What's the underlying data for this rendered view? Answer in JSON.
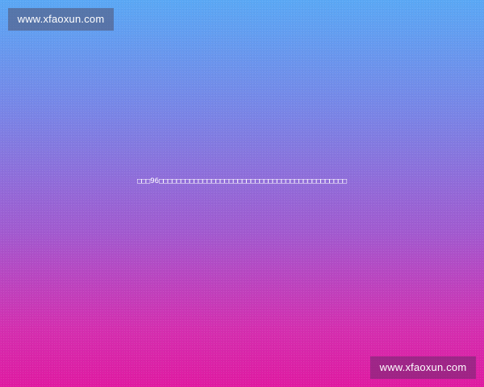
{
  "watermark": {
    "top_text": "www.xfaoxun.com",
    "bottom_text": "www.xfaoxun.com"
  },
  "center": {
    "text": "□□□96□□□□□□□□□□□□□□□□□□□□□□□□□□□□□□□□□□□□□□□□□□□"
  },
  "colors": {
    "gradient_top": "#5aa8f5",
    "gradient_bottom": "#e01aa2"
  }
}
